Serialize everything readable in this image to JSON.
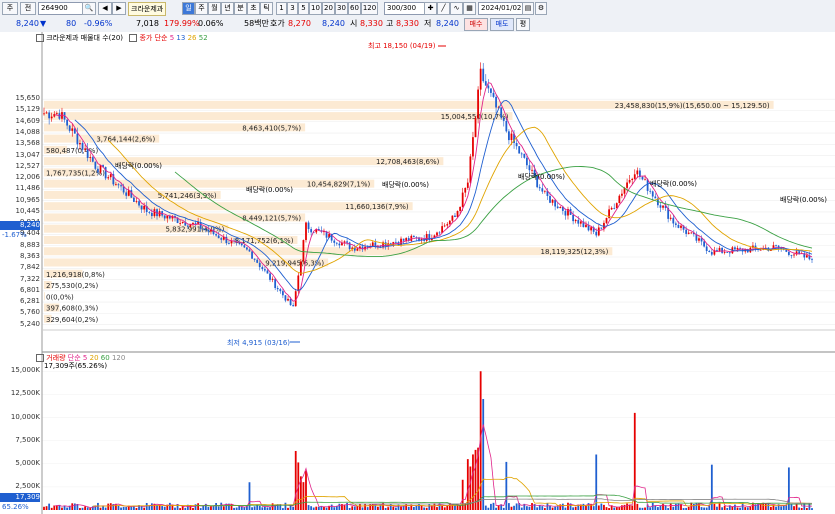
{
  "toolbar": {
    "menu_label": "주",
    "menu2_label": "전",
    "code": "264900",
    "name": "크라운제과",
    "periods": [
      "일",
      "주",
      "월",
      "년",
      "분",
      "초",
      "틱"
    ],
    "minutes": [
      "1",
      "3",
      "5",
      "10",
      "20",
      "30",
      "60",
      "120"
    ],
    "count": "300/300",
    "date": "2024/01/02",
    "buy_label": "매수",
    "sell_label": "매도",
    "eval_label": "평"
  },
  "quote": {
    "price": "8,240",
    "change": "80",
    "change_pct": "-0.96%",
    "volume": "7,018",
    "ratio": "179.99%",
    "turnover": "0.06%",
    "amount": "58백만",
    "quote_label": "호가",
    "ask": "8,270",
    "bid": "8,240",
    "open_label": "시",
    "open": "8,330",
    "high_label": "고",
    "high": "8,330",
    "low_label": "저",
    "low": "8,240"
  },
  "price_panel": {
    "legend_name": "크라운제과 매물대 수(20)",
    "legend_ma": "종가 단순",
    "ma_periods": [
      "5",
      "13",
      "26",
      "52"
    ],
    "ma_colors": [
      "#e0248a",
      "#1f5fd0",
      "#e0a400",
      "#3aa043"
    ],
    "high_label": "최고 18,150 (04/19)",
    "low_label": "최저 4,915 (03/16)",
    "current_price": "8,240",
    "current_change": "-1.67%",
    "axis_ticks": [
      "15,650",
      "15,129",
      "14,609",
      "14,088",
      "13,568",
      "13,047",
      "12,527",
      "12,006",
      "11,486",
      "10,965",
      "10,445",
      "9,924",
      "9,404",
      "8,883",
      "8,363",
      "7,842",
      "7,322",
      "6,801",
      "6,281",
      "5,760",
      "5,240"
    ],
    "dividend_label": "배당락(0.00%)",
    "volume_profile": [
      {
        "label": "23,458,830(15,9%)(15,650.00 ~ 15,129.50)",
        "price": 15390,
        "frac": 0.95
      },
      {
        "label": "15,004,550(10,7%)",
        "price": 14870,
        "frac": 0.61
      },
      {
        "label": "8,463,410(5,7%)",
        "price": 14350,
        "frac": 0.34
      },
      {
        "label": "3,764,144(2,6%)",
        "price": 13830,
        "frac": 0.15
      },
      {
        "label": "580,487(0,4%)",
        "price": 13310,
        "frac": 0.03
      },
      {
        "label": "12,708,463(8,6%)",
        "price": 12790,
        "frac": 0.52
      },
      {
        "label": "1,767,735(1,2%)",
        "price": 12270,
        "frac": 0.07
      },
      {
        "label": "10,454,829(7,1%)",
        "price": 11750,
        "frac": 0.43
      },
      {
        "label": "5,741,246(3,9%)",
        "price": 11230,
        "frac": 0.23
      },
      {
        "label": "11,660,136(7,9%)",
        "price": 10710,
        "frac": 0.48
      },
      {
        "label": "8,449,121(5,7%)",
        "price": 10190,
        "frac": 0.34
      },
      {
        "label": "5,832,991(4,0%)",
        "price": 9670,
        "frac": 0.24
      },
      {
        "label": "8,171,752(6,1%)",
        "price": 9150,
        "frac": 0.33
      },
      {
        "label": "18,119,325(12,3%)",
        "price": 8630,
        "frac": 0.74
      },
      {
        "label": "9,219,945(6,3%)",
        "price": 8110,
        "frac": 0.37
      },
      {
        "label": "1,216,918(0,8%)",
        "price": 7590,
        "frac": 0.05
      },
      {
        "label": "275,530(0,2%)",
        "price": 7070,
        "frac": 0.01
      },
      {
        "label": "0(0,0%)",
        "price": 6550,
        "frac": 0.0
      },
      {
        "label": "397,608(0,3%)",
        "price": 6030,
        "frac": 0.02
      },
      {
        "label": "329,604(0,2%)",
        "price": 5510,
        "frac": 0.01
      }
    ]
  },
  "volume_panel": {
    "legend_name": "거래량",
    "legend_ma": "단순",
    "ma_periods": [
      "5",
      "20",
      "60",
      "120"
    ],
    "ma_colors": [
      "#e0248a",
      "#e0a400",
      "#3aa043",
      "#888888"
    ],
    "current": "17,309주(65.26%)",
    "axis_ticks": [
      "15,000K",
      "12,500K",
      "10,000K",
      "7,500K",
      "5,000K",
      "2,500K"
    ],
    "current_value": "17,309",
    "current_pct": "65.26%"
  },
  "chart_data": {
    "type": "candlestick",
    "ylim": [
      4900,
      18200
    ],
    "volume_ylim": [
      0,
      16000
    ],
    "peaks": [
      {
        "day": 6,
        "close": 15000
      },
      {
        "day": 20,
        "close": 12600
      },
      {
        "day": 40,
        "close": 10500
      },
      {
        "day": 60,
        "close": 9800
      },
      {
        "day": 80,
        "close": 8600
      },
      {
        "day": 97,
        "close": 6000
      },
      {
        "day": 102,
        "close": 9800
      },
      {
        "day": 120,
        "close": 8800
      },
      {
        "day": 150,
        "close": 9300
      },
      {
        "day": 160,
        "close": 10200
      },
      {
        "day": 165,
        "close": 11800
      },
      {
        "day": 170,
        "close": 16800
      },
      {
        "day": 180,
        "close": 14200
      },
      {
        "day": 195,
        "close": 11200
      },
      {
        "day": 215,
        "close": 9400
      },
      {
        "day": 230,
        "close": 12400
      },
      {
        "day": 245,
        "close": 10000
      },
      {
        "day": 260,
        "close": 8600
      },
      {
        "day": 285,
        "close": 8800
      },
      {
        "day": 299,
        "close": 8240
      }
    ]
  }
}
